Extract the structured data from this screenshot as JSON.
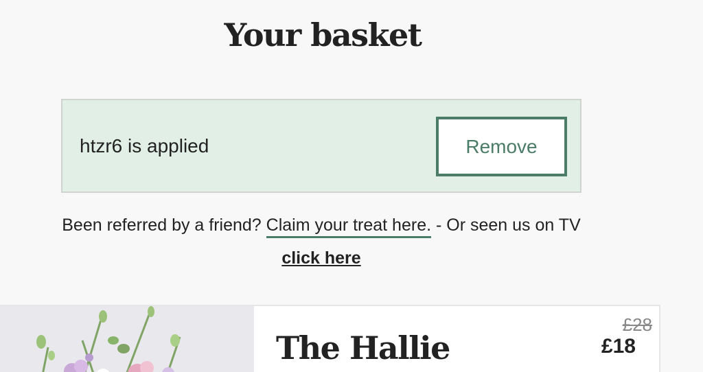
{
  "page": {
    "title": "Your basket"
  },
  "promo": {
    "applied_text": "htzr6 is applied",
    "remove_label": "Remove",
    "accent_color": "#4a7c68",
    "background_color": "#e2efe7"
  },
  "referral": {
    "prefix": "Been referred by a friend?",
    "claim_link": "Claim your treat here.",
    "middle": " - Or seen us on TV",
    "tv_link": "click here"
  },
  "product": {
    "name": "The Hallie",
    "old_price": "£28",
    "new_price": "£18",
    "image_icon": "flower-bouquet-image"
  }
}
